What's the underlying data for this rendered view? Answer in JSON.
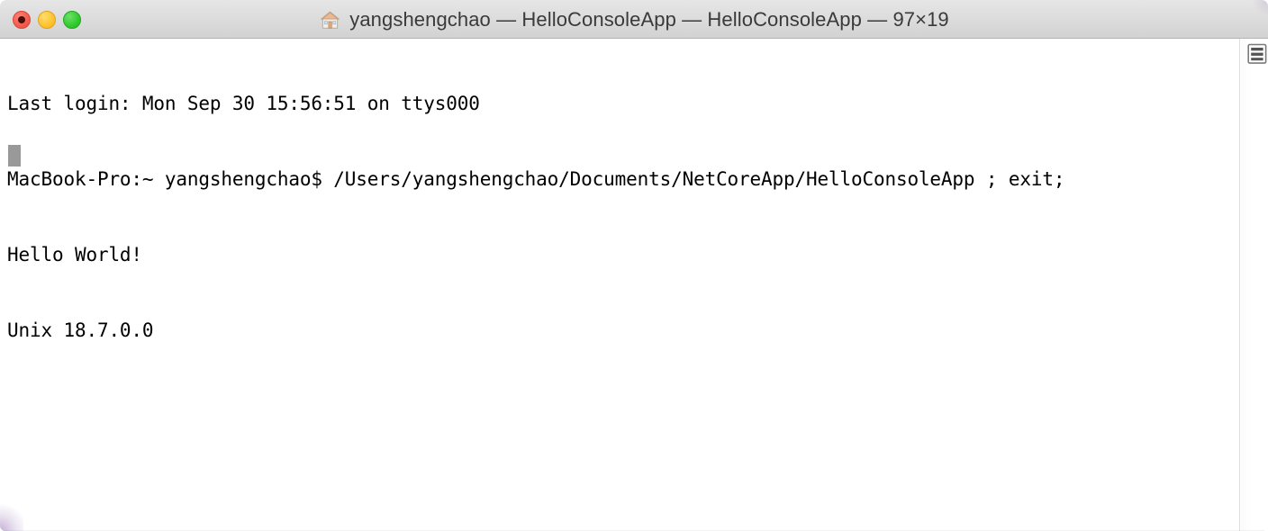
{
  "window": {
    "title": "yangshengchao — HelloConsoleApp — HelloConsoleApp — 97×19",
    "title_icon": "home-folder-icon",
    "columns": 97,
    "rows": 19,
    "traffic_lights": {
      "close_label": "Close",
      "minimize_label": "Minimize",
      "zoom_label": "Zoom",
      "close_color": "#f35c4e",
      "minimize_color": "#ffc22e",
      "zoom_color": "#2fca2c"
    },
    "background_color": "#ffffff",
    "titlebar_color": "#dcdcdc"
  },
  "terminal": {
    "foreground_color": "#000000",
    "cursor_color": "#999999",
    "lines": [
      "Last login: Mon Sep 30 15:56:51 on ttys000",
      "MacBook-Pro:~ yangshengchao$ /Users/yangshengchao/Documents/NetCoreApp/HelloConsoleApp ; exit;",
      "Hello World!",
      "Unix 18.7.0.0"
    ],
    "line_details": {
      "line1": "Last login: Mon Sep 30 15:56:51 on ttys000",
      "line2": "MacBook-Pro:~ yangshengchao$ /Users/yangshengchao/Documents/NetCoreApp/HelloConsoleApp ; exit;",
      "line3": "Hello World!",
      "line4": "Unix 18.7.0.0"
    },
    "prompt": "MacBook-Pro:~ yangshengchao$",
    "command": "/Users/yangshengchao/Documents/NetCoreApp/HelloConsoleApp ; exit;",
    "cursor_visible": true
  },
  "scrollbar": {
    "marker_icon": "lines-marker-icon",
    "thumb_visible": false
  }
}
